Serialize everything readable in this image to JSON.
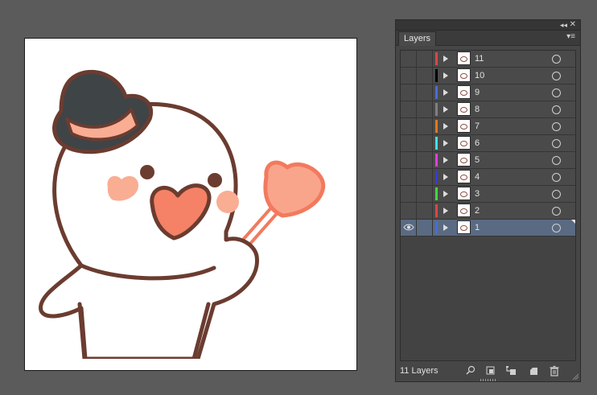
{
  "panel": {
    "tab_label": "Layers",
    "collapse_icon": "double-chevron-left-icon",
    "close_icon": "close-icon",
    "menu_icon": "panel-menu-icon",
    "layer_count": "11 Layers"
  },
  "layers": [
    {
      "name": "11",
      "color": "#d84848"
    },
    {
      "name": "10",
      "color": "#000000"
    },
    {
      "name": "9",
      "color": "#4a6cd8"
    },
    {
      "name": "8",
      "color": "#808080"
    },
    {
      "name": "7",
      "color": "#e07818"
    },
    {
      "name": "6",
      "color": "#40e0e8"
    },
    {
      "name": "5",
      "color": "#e040d8"
    },
    {
      "name": "4",
      "color": "#3a3ad8"
    },
    {
      "name": "3",
      "color": "#40d840"
    },
    {
      "name": "2",
      "color": "#d84848"
    },
    {
      "name": "1",
      "color": "#4a6cd8",
      "selected": true,
      "visible": true
    }
  ],
  "footer_icons": [
    "search-layer-icon",
    "make-clipping-mask-icon",
    "create-sublayer-icon",
    "create-new-layer-icon",
    "delete-layer-icon"
  ]
}
